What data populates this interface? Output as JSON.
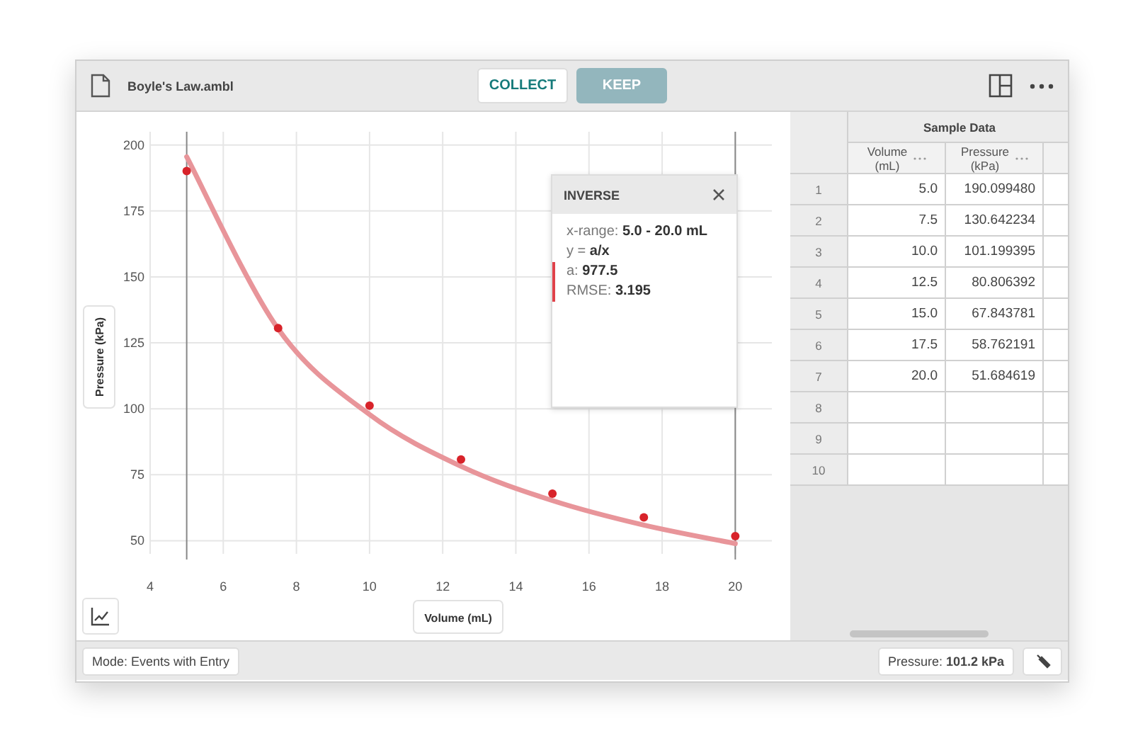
{
  "window": {
    "file_name": "Boyle's Law.ambl",
    "buttons": [
      {
        "label": "COLLECT",
        "disabled": false
      },
      {
        "label": "KEEP",
        "disabled": true
      }
    ]
  },
  "graph": {
    "chart_data": {
      "type": "scatter",
      "xlabel": "Volume (mL)",
      "ylabel": "Pressure (kPa)",
      "x": [
        5,
        7.5,
        10,
        12.5,
        15,
        17.5,
        20
      ],
      "series": [
        {
          "type": "scatter",
          "color": "#d8232a",
          "values": [
            190.1,
            130.6,
            101.2,
            80.8,
            67.8,
            58.8,
            51.7
          ]
        },
        {
          "type": "line",
          "color": "#e8959a",
          "values": [
            195.5,
            130.3,
            97.8,
            78.2,
            65.2,
            55.9,
            48.9
          ]
        }
      ],
      "grid": true,
      "ref_lines": [
        {
          "axis": "x",
          "value": 5
        },
        {
          "axis": "x",
          "value": 20
        }
      ],
      "xlim": [
        4,
        21
      ],
      "ylim": [
        45,
        205
      ],
      "xticks": [
        4,
        6,
        8,
        10,
        12,
        14,
        16,
        18,
        20
      ],
      "yticks": [
        50,
        75,
        100,
        125,
        150,
        175,
        200
      ]
    },
    "fit_panel": {
      "title": "INVERSE",
      "lines": [
        {
          "label": "x-range:",
          "value": "5.0 - 20.0 mL",
          "marked": false
        },
        {
          "label": "y =",
          "value": "a/x",
          "marked": false
        },
        {
          "label": "a:",
          "value": "977.5",
          "marked": true
        },
        {
          "label": "RMSE:",
          "value": "3.195",
          "marked": true
        }
      ]
    }
  },
  "table": {
    "title": "Sample Data",
    "columns": [
      {
        "name": "Volume",
        "unit": "(mL)"
      },
      {
        "name": "Pressure",
        "unit": "(kPa)"
      }
    ],
    "rows": [
      {
        "index": "1",
        "cells": [
          "5.0",
          "190.099480"
        ]
      },
      {
        "index": "2",
        "cells": [
          "7.5",
          "130.642234"
        ]
      },
      {
        "index": "3",
        "cells": [
          "10.0",
          "101.199395"
        ]
      },
      {
        "index": "4",
        "cells": [
          "12.5",
          "80.806392"
        ]
      },
      {
        "index": "5",
        "cells": [
          "15.0",
          "67.843781"
        ]
      },
      {
        "index": "6",
        "cells": [
          "17.5",
          "58.762191"
        ]
      },
      {
        "index": "7",
        "cells": [
          "20.0",
          "51.684619"
        ]
      },
      {
        "index": "8",
        "cells": []
      },
      {
        "index": "9",
        "cells": []
      },
      {
        "index": "10",
        "cells": []
      }
    ]
  },
  "status_bar": {
    "mode": "Mode: Events with Entry",
    "meter": "Pressure: **101.2 kPa**"
  }
}
